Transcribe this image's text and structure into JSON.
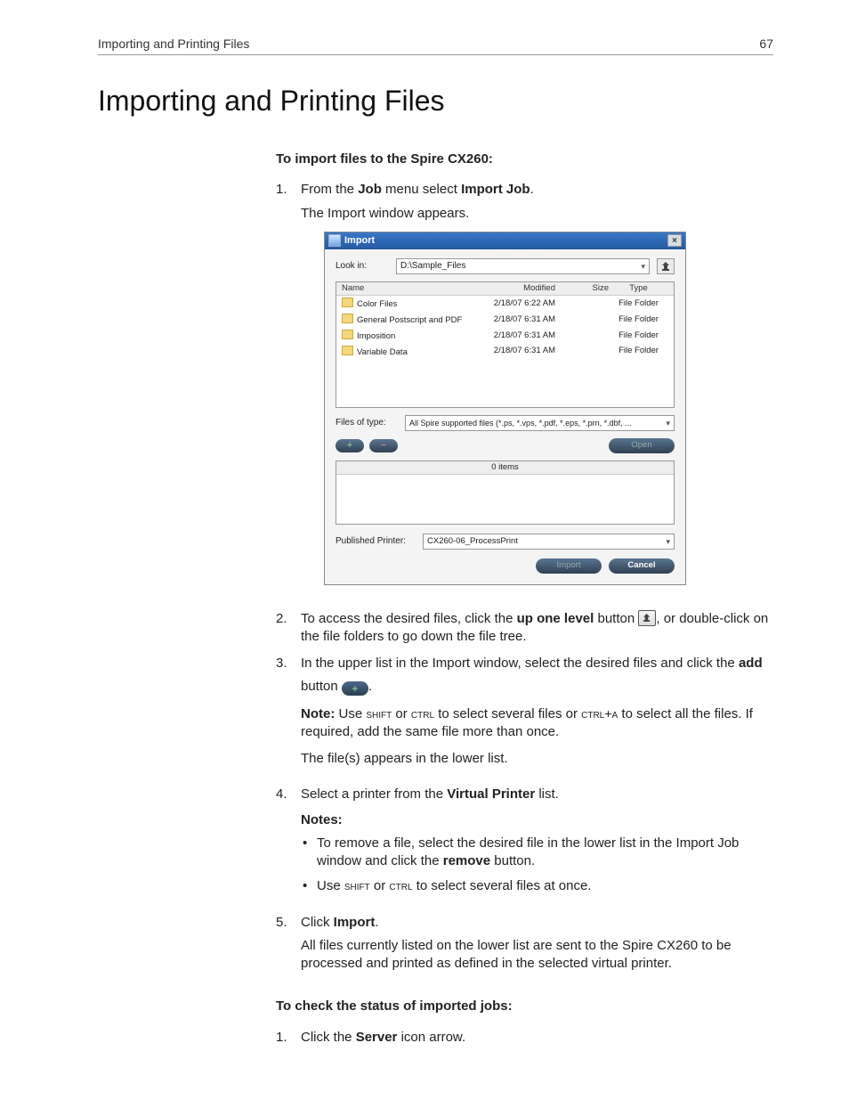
{
  "header": {
    "left": "Importing and Printing Files",
    "right": "67"
  },
  "title": "Importing and Printing Files",
  "sec1": {
    "heading": "To import files to the Spire CX260:",
    "s1": {
      "num": "1.",
      "a": "From the ",
      "b": "Job",
      "c": " menu select ",
      "d": "Import Job",
      "e": ".",
      "f": "The Import window appears."
    },
    "s2": {
      "num": "2.",
      "a": "To access the desired files, click the ",
      "b": "up one level",
      "c": " button ",
      "d": ", or double-click on the file folders to go down the file tree."
    },
    "s3": {
      "num": "3.",
      "a": "In the upper list in the Import window, select the desired files and click the ",
      "b": "add",
      "c": "button ",
      "d": ".",
      "note_a": "Note:",
      "note_b": "  Use ",
      "note_c": "shift",
      "note_d": " or ",
      "note_e": "ctrl",
      "note_f": " to select several files or ",
      "note_g": "ctrl+a",
      "note_h": " to select all the files. If required, add the same file more than once.",
      "g": "The file(s) appears in the lower list."
    },
    "s4": {
      "num": "4.",
      "a": "Select a printer from the ",
      "b": "Virtual Printer",
      "c": " list.",
      "notes_head": "Notes:",
      "b1a": "To remove a file, select the desired file in the lower list in the Import Job window and click the ",
      "b1b": "remove",
      "b1c": " button.",
      "b2a": "Use ",
      "b2b": "shift",
      "b2c": " or ",
      "b2d": "ctrl",
      "b2e": " to select several files at once."
    },
    "s5": {
      "num": "5.",
      "a": "Click ",
      "b": "Import",
      "c": ".",
      "d": "All files currently listed on the lower list are sent to the Spire CX260 to be processed and printed as defined in the selected virtual printer."
    }
  },
  "sec2": {
    "heading": "To check the status of imported jobs:",
    "s1": {
      "num": "1.",
      "a": "Click the ",
      "b": "Server",
      "c": " icon arrow."
    }
  },
  "dialog": {
    "title": "Import",
    "lookin_label": "Look in:",
    "path": "D:\\Sample_Files",
    "cols": {
      "name": "Name",
      "modified": "Modified",
      "size": "Size",
      "type": "Type"
    },
    "rows": [
      {
        "name": "Color Files",
        "mod": "2/18/07 6:22 AM",
        "size": "",
        "type": "File Folder"
      },
      {
        "name": "General Postscript and PDF",
        "mod": "2/18/07 6:31 AM",
        "size": "",
        "type": "File Folder"
      },
      {
        "name": "Imposition",
        "mod": "2/18/07 6:31 AM",
        "size": "",
        "type": "File Folder"
      },
      {
        "name": "Variable Data",
        "mod": "2/18/07 6:31 AM",
        "size": "",
        "type": "File Folder"
      }
    ],
    "type_label": "Files of type:",
    "type_value": "All Spire supported files (*.ps, *.vps, *.pdf, *.eps, *.prn, *.dbf, ...",
    "open": "Open",
    "lower_head": "0 items",
    "vp_label": "Published Printer:",
    "vp_value": "CX260-06_ProcessPrint",
    "import_btn": "Import",
    "cancel_btn": "Cancel"
  }
}
